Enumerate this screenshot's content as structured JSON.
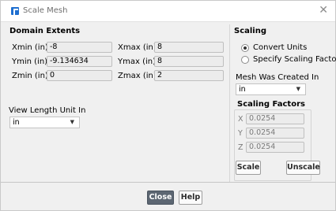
{
  "window": {
    "title": "Scale Mesh",
    "close_glyph": "✕"
  },
  "domain_extents": {
    "title": "Domain Extents",
    "xmin": {
      "label": "Xmin (in)",
      "value": "-8"
    },
    "xmax": {
      "label": "Xmax (in)",
      "value": "8"
    },
    "ymin": {
      "label": "Ymin (in)",
      "value": "-9.134634"
    },
    "ymax": {
      "label": "Ymax (in)",
      "value": "8"
    },
    "zmin": {
      "label": "Zmin (in)",
      "value": "0"
    },
    "zmax": {
      "label": "Zmax (in)",
      "value": "2"
    }
  },
  "view_length_unit": {
    "label": "View Length Unit In",
    "value": "in"
  },
  "scaling": {
    "title": "Scaling",
    "options": [
      {
        "label": "Convert Units",
        "selected": true
      },
      {
        "label": "Specify Scaling Factors",
        "selected": false
      }
    ],
    "mesh_created_label": "Mesh Was Created In",
    "mesh_created_value": "in",
    "factors_title": "Scaling Factors",
    "x": {
      "label": "X",
      "value": "0.0254"
    },
    "y": {
      "label": "Y",
      "value": "0.0254"
    },
    "z": {
      "label": "Z",
      "value": "0.0254"
    },
    "scale_label": "Scale",
    "unscale_label": "Unscale"
  },
  "footer": {
    "close_label": "Close",
    "help_label": "Help"
  },
  "icons": {
    "app": "app-icon",
    "close": "close-icon",
    "dropdown": "chevron-down-icon"
  },
  "colors": {
    "primary_button": "#5c6672",
    "dialog_bg": "#f0f0f0",
    "app_icon": "#1e6fd0"
  }
}
